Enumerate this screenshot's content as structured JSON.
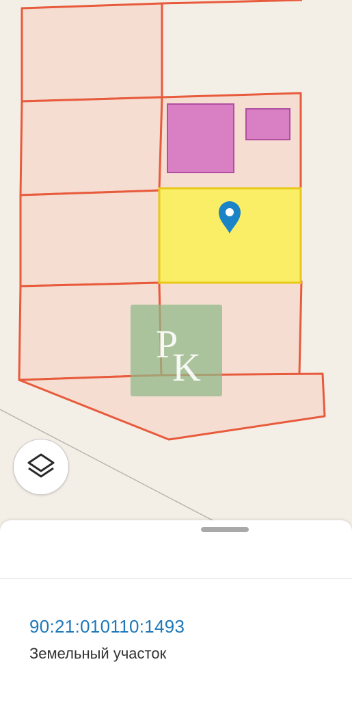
{
  "map": {
    "parcels": {
      "fill": "#f5ddd1",
      "stroke": "#e85a3c"
    },
    "selected_parcel": {
      "fill": "#f9ee65",
      "stroke": "#e8c91a"
    },
    "buildings": {
      "fill": "#d97fc4",
      "stroke": "#b04fa0"
    },
    "marker": {
      "icon": "map-pin-icon",
      "color": "#1a84c6"
    },
    "watermark": {
      "text": "РК",
      "color": "#8fb888"
    }
  },
  "controls": {
    "layers_icon": "layers-icon"
  },
  "info_sheet": {
    "cadastral_number": "90:21:010110:1493",
    "object_type": "Земельный участок"
  }
}
